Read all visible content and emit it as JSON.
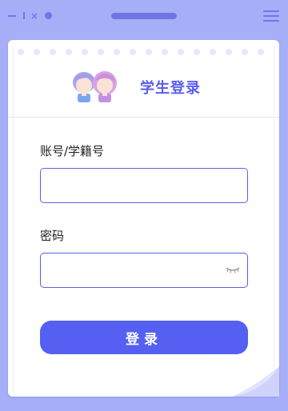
{
  "window": {
    "close_glyph": "×",
    "controls": [
      "minimize-icon",
      "maximize-icon",
      "close-icon",
      "dot-icon",
      "handle-icon",
      "menu-icon"
    ]
  },
  "header": {
    "title": "学生登录",
    "mascot_icon": "students-icon"
  },
  "form": {
    "account_label": "账号/学籍号",
    "account_value": "",
    "account_placeholder": "",
    "password_label": "密码",
    "password_value": "",
    "password_placeholder": "",
    "password_toggle_icon": "eye-closed-icon"
  },
  "actions": {
    "login_label": "登录"
  },
  "colors": {
    "background": "#a7aef8",
    "accent": "#5560f2",
    "title": "#5a5ef0",
    "input_border": "#5c5fe0"
  }
}
